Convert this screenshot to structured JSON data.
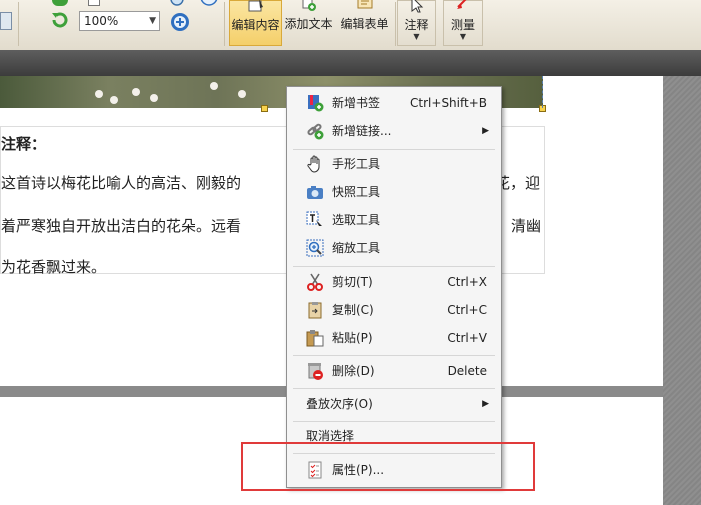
{
  "toolbar": {
    "zoom_value": "100%",
    "buttons": [
      {
        "label": "编辑内容",
        "active": true
      },
      {
        "label": "添加文本",
        "active": false
      },
      {
        "label": "编辑表单",
        "active": false
      },
      {
        "label": "注释",
        "active": false,
        "dropdown": true
      },
      {
        "label": "测量",
        "active": false,
        "dropdown": true
      }
    ]
  },
  "document": {
    "heading": "注释：",
    "lines": [
      "这首诗以梅花比喻人的高洁、刚毅的",
      "着严寒独自开放出洁白的花朵。远看",
      "为花香飘过来。"
    ],
    "right_fragments": [
      "花，迎",
      "清幽"
    ]
  },
  "context_menu": {
    "groups": [
      [
        {
          "label": "新增书签",
          "shortcut": "Ctrl+Shift+B",
          "icon": "bookmark-add-icon"
        },
        {
          "label": "新增链接...",
          "submenu": true,
          "icon": "link-add-icon"
        }
      ],
      [
        {
          "label": "手形工具",
          "icon": "hand-tool-icon"
        },
        {
          "label": "快照工具",
          "icon": "camera-icon"
        },
        {
          "label": "选取工具",
          "icon": "select-text-icon"
        },
        {
          "label": "缩放工具",
          "icon": "zoom-tool-icon"
        }
      ],
      [
        {
          "label": "剪切(T)",
          "shortcut": "Ctrl+X",
          "icon": "scissors-icon"
        },
        {
          "label": "复制(C)",
          "shortcut": "Ctrl+C",
          "icon": "copy-icon"
        },
        {
          "label": "粘贴(P)",
          "shortcut": "Ctrl+V",
          "icon": "paste-icon"
        }
      ],
      [
        {
          "label": "删除(D)",
          "shortcut": "Delete",
          "icon": "delete-icon"
        }
      ],
      [
        {
          "label": "叠放次序(O)",
          "submenu": true
        }
      ],
      [
        {
          "label": "取消选择"
        }
      ],
      [
        {
          "label": "属性(P)...",
          "icon": "properties-icon"
        }
      ]
    ]
  },
  "colors": {
    "highlight_box": "#e03a3a",
    "active_button": "#f4cf6a",
    "strip_accent": "#e2a43c"
  }
}
